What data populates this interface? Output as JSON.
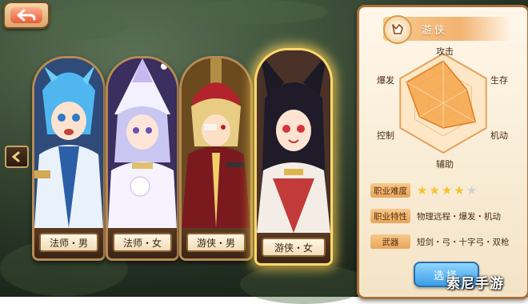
{
  "characters": [
    {
      "label": "法师・男"
    },
    {
      "label": "法师・女"
    },
    {
      "label": "游侠・男"
    },
    {
      "label": "游侠・女"
    }
  ],
  "panel": {
    "class_name": "游侠",
    "radar": {
      "axes": [
        "攻击",
        "生存",
        "机动",
        "辅助",
        "控制",
        "爆发"
      ],
      "values": [
        0.85,
        0.55,
        0.75,
        0.5,
        0.55,
        0.85
      ]
    },
    "difficulty_label": "职业难度",
    "difficulty_stars": 4,
    "difficulty_max": 5,
    "trait_label": "职业特性",
    "trait_value": "物理远程・爆发・机动",
    "weapon_label": "武器",
    "weapon_value": "短剑・弓・十字弓・双枪",
    "select_label": "选择"
  },
  "watermark": "索尼手游",
  "colors": {
    "accent_gold": "#ffd86a",
    "star_filled": "#f7c22d",
    "star_empty": "#cfcfcf",
    "select_blue": "#3d9de6"
  }
}
